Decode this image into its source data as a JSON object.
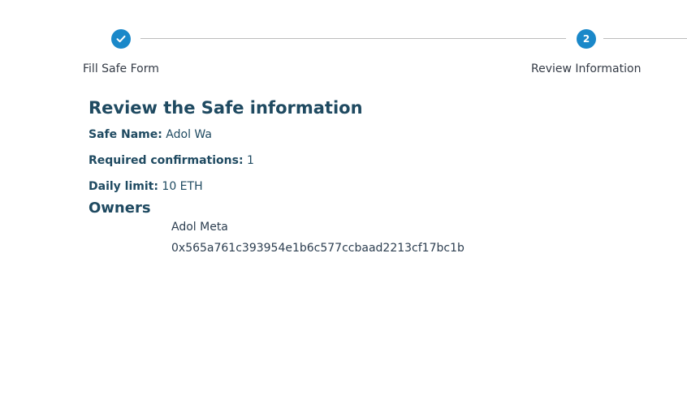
{
  "stepper": {
    "step1": {
      "label": "Fill Safe Form",
      "done": true
    },
    "step2": {
      "number": "2",
      "label": "Review Information"
    }
  },
  "review": {
    "title": "Review the Safe information",
    "safe_name_label": "Safe Name:",
    "safe_name_value": "Adol Wa",
    "confirmations_label": "Required confirmations:",
    "confirmations_value": "1",
    "daily_limit_label": "Daily limit:",
    "daily_limit_value": "10 ETH"
  },
  "owners": {
    "title": "Owners",
    "items": [
      {
        "name": "Adol Meta",
        "address": "0x565a761c393954e1b6c577ccbaad2213cf17bc1b"
      }
    ]
  },
  "colors": {
    "accent": "#1a88c9",
    "heading": "#1f4a61"
  },
  "icons": {
    "step1": "check-icon"
  }
}
